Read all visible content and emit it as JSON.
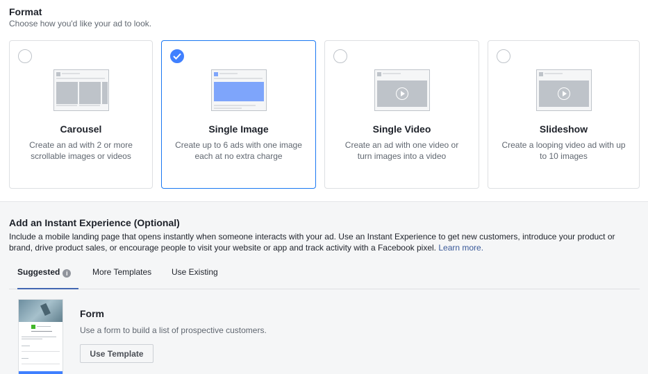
{
  "format": {
    "title": "Format",
    "subtitle": "Choose how you'd like your ad to look."
  },
  "cards": [
    {
      "title": "Carousel",
      "description": "Create an ad with 2 or more scrollable images or videos",
      "selected": false,
      "icon": "carousel-preview-icon"
    },
    {
      "title": "Single Image",
      "description": "Create up to 6 ads with one image each at no extra charge",
      "selected": true,
      "icon": "single-image-preview-icon"
    },
    {
      "title": "Single Video",
      "description": "Create an ad with one video or turn images into a video",
      "selected": false,
      "icon": "single-video-preview-icon"
    },
    {
      "title": "Slideshow",
      "description": "Create a looping video ad with up to 10 images",
      "selected": false,
      "icon": "slideshow-preview-icon"
    }
  ],
  "instant": {
    "title": "Add an Instant Experience (Optional)",
    "description": "Include a mobile landing page that opens instantly when someone interacts with your ad. Use an Instant Experience to get new customers, introduce your product or brand, drive product sales, or encourage people to visit your website or app and track activity with a Facebook pixel.",
    "learn_more": "Learn more."
  },
  "tabs": [
    {
      "label": "Suggested",
      "active": true,
      "icon": "info-icon"
    },
    {
      "label": "More Templates",
      "active": false
    },
    {
      "label": "Use Existing",
      "active": false
    }
  ],
  "template": {
    "title": "Form",
    "description": "Use a form to build a list of prospective customers.",
    "button_label": "Use Template"
  },
  "colors": {
    "accent": "#4080ff",
    "selected_border": "#1877f2",
    "link": "#385898"
  }
}
